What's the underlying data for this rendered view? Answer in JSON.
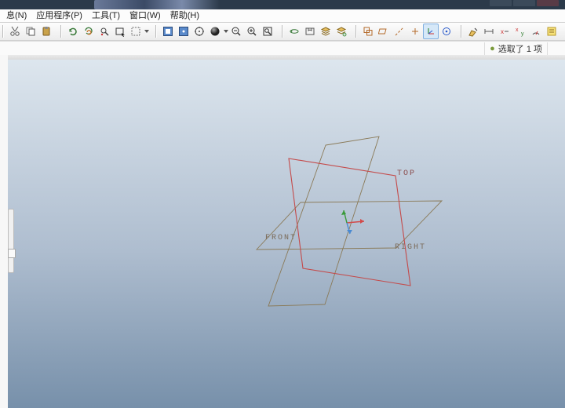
{
  "window": {
    "min": "_",
    "max": "□",
    "close": "×"
  },
  "menubar": [
    {
      "key": "info",
      "label": "息(N)"
    },
    {
      "key": "app",
      "label": "应用程序(P)"
    },
    {
      "key": "tools",
      "label": "工具(T)"
    },
    {
      "key": "window",
      "label": "窗口(W)"
    },
    {
      "key": "help",
      "label": "帮助(H)"
    }
  ],
  "toolbar": {
    "edit": [
      {
        "n": "cut-icon"
      },
      {
        "n": "copy-icon"
      },
      {
        "n": "paste-icon"
      }
    ],
    "regen": [
      {
        "n": "regen-icon"
      },
      {
        "n": "regen-all-icon"
      },
      {
        "n": "search-model-icon"
      },
      {
        "n": "box-select-icon"
      },
      {
        "n": "lasso-select-icon",
        "drop": true
      }
    ],
    "view": [
      {
        "n": "refit-icon"
      },
      {
        "n": "window-zoom-icon"
      },
      {
        "n": "orient-icon"
      },
      {
        "n": "shade-sphere-icon",
        "drop": true
      },
      {
        "n": "zoom-out-icon"
      },
      {
        "n": "zoom-in-icon"
      },
      {
        "n": "zoom-area-icon"
      }
    ],
    "display": [
      {
        "n": "spin-icon"
      },
      {
        "n": "saved-view-icon"
      },
      {
        "n": "layers-icon"
      },
      {
        "n": "layers-plus-icon"
      }
    ],
    "datum": [
      {
        "n": "sys-disp-icon"
      },
      {
        "n": "plane-disp-icon"
      },
      {
        "n": "axis-disp-icon"
      },
      {
        "n": "point-disp-icon"
      },
      {
        "n": "csys-disp-icon",
        "active": true
      },
      {
        "n": "annot-disp-icon"
      }
    ],
    "annot": [
      {
        "n": "note-icon"
      },
      {
        "n": "dim-icon"
      },
      {
        "n": "x-dim-icon"
      },
      {
        "n": "xy-dim-icon"
      },
      {
        "n": "gauge-icon"
      },
      {
        "n": "highlight-icon"
      }
    ]
  },
  "helpcursor": "▶?",
  "status": {
    "icon": "●",
    "text": "选取了 1 项"
  },
  "datums": {
    "top": "TOP",
    "front": "FRONT",
    "right": "RIGHT"
  }
}
